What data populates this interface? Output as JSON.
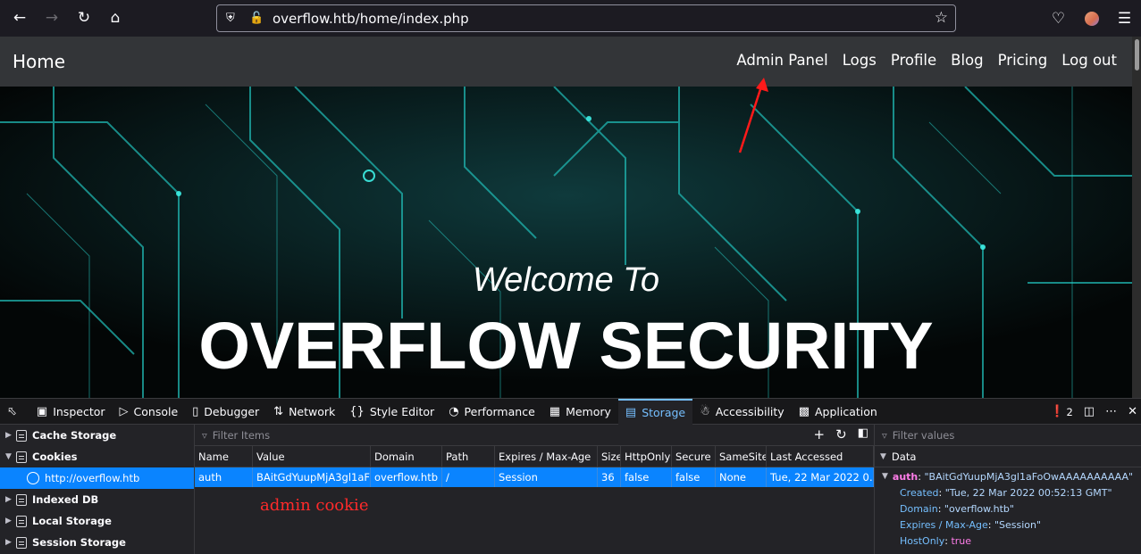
{
  "browser": {
    "url": "overflow.htb/home/index.php"
  },
  "site": {
    "brand": "Home",
    "nav": [
      "Admin Panel",
      "Logs",
      "Profile",
      "Blog",
      "Pricing",
      "Log out"
    ],
    "hero_sub": "Welcome To",
    "hero_title": "OVERFLOW SECURITY"
  },
  "devtools": {
    "tabs": [
      "Inspector",
      "Console",
      "Debugger",
      "Network",
      "Style Editor",
      "Performance",
      "Memory",
      "Storage",
      "Accessibility",
      "Application"
    ],
    "active_tab": "Storage",
    "error_count": "2",
    "sidebar": {
      "cache_storage": "Cache Storage",
      "cookies": "Cookies",
      "cookie_host": "http://overflow.htb",
      "indexed_db": "Indexed DB",
      "local_storage": "Local Storage",
      "session_storage": "Session Storage"
    },
    "filter_placeholder": "Filter Items",
    "columns": [
      "Name",
      "Value",
      "Domain",
      "Path",
      "Expires / Max-Age",
      "Size",
      "HttpOnly",
      "Secure",
      "SameSite",
      "Last Accessed"
    ],
    "row": [
      "auth",
      "BAitGdYuupMjA3gl1aF…",
      "overflow.htb",
      "/",
      "Session",
      "36",
      "false",
      "false",
      "None",
      "Tue, 22 Mar 2022 0…"
    ],
    "annotation": "admin cookie",
    "data_pane": {
      "filter_placeholder": "Filter values",
      "header": "Data",
      "auth_key": "auth",
      "auth_value": "\"BAitGdYuupMjA3gl1aFoOwAAAAAAAAAA\"",
      "created_key": "Created",
      "created_value": "\"Tue, 22 Mar 2022 00:52:13 GMT\"",
      "domain_key": "Domain",
      "domain_value": "\"overflow.htb\"",
      "expires_key": "Expires / Max-Age",
      "expires_value": "\"Session\"",
      "hostonly_key": "HostOnly",
      "hostonly_value": "true"
    }
  },
  "colors": {
    "accent": "#0a84ff",
    "annotation": "#ff2a2a"
  }
}
